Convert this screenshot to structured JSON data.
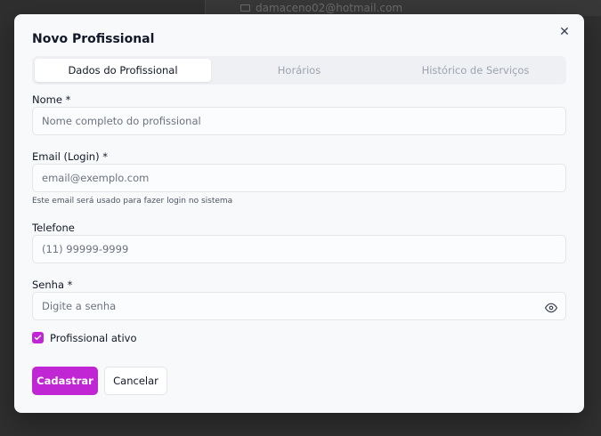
{
  "background": {
    "email": "damaceno02@hotmail.com"
  },
  "modal": {
    "title": "Novo Profissional",
    "close_icon": "close-icon",
    "tabs": [
      {
        "label": "Dados do Profissional",
        "active": true
      },
      {
        "label": "Horários",
        "active": false
      },
      {
        "label": "Histórico de Serviços",
        "active": false
      }
    ],
    "fields": {
      "nome": {
        "label": "Nome *",
        "placeholder": "Nome completo do profissional",
        "value": ""
      },
      "email": {
        "label": "Email (Login) *",
        "placeholder": "email@exemplo.com",
        "value": "",
        "hint": "Este email será usado para fazer login no sistema"
      },
      "telefone": {
        "label": "Telefone",
        "placeholder": "(11) 99999-9999",
        "value": ""
      },
      "senha": {
        "label": "Senha *",
        "placeholder": "Digite a senha",
        "value": "",
        "icon": "eye-icon"
      }
    },
    "ativo": {
      "label": "Profissional ativo",
      "checked": true
    },
    "buttons": {
      "submit": "Cadastrar",
      "cancel": "Cancelar"
    }
  },
  "colors": {
    "accent": "#c026d3",
    "overlay": "#2f2f2f",
    "modal_bg": "#f8f9fb"
  }
}
